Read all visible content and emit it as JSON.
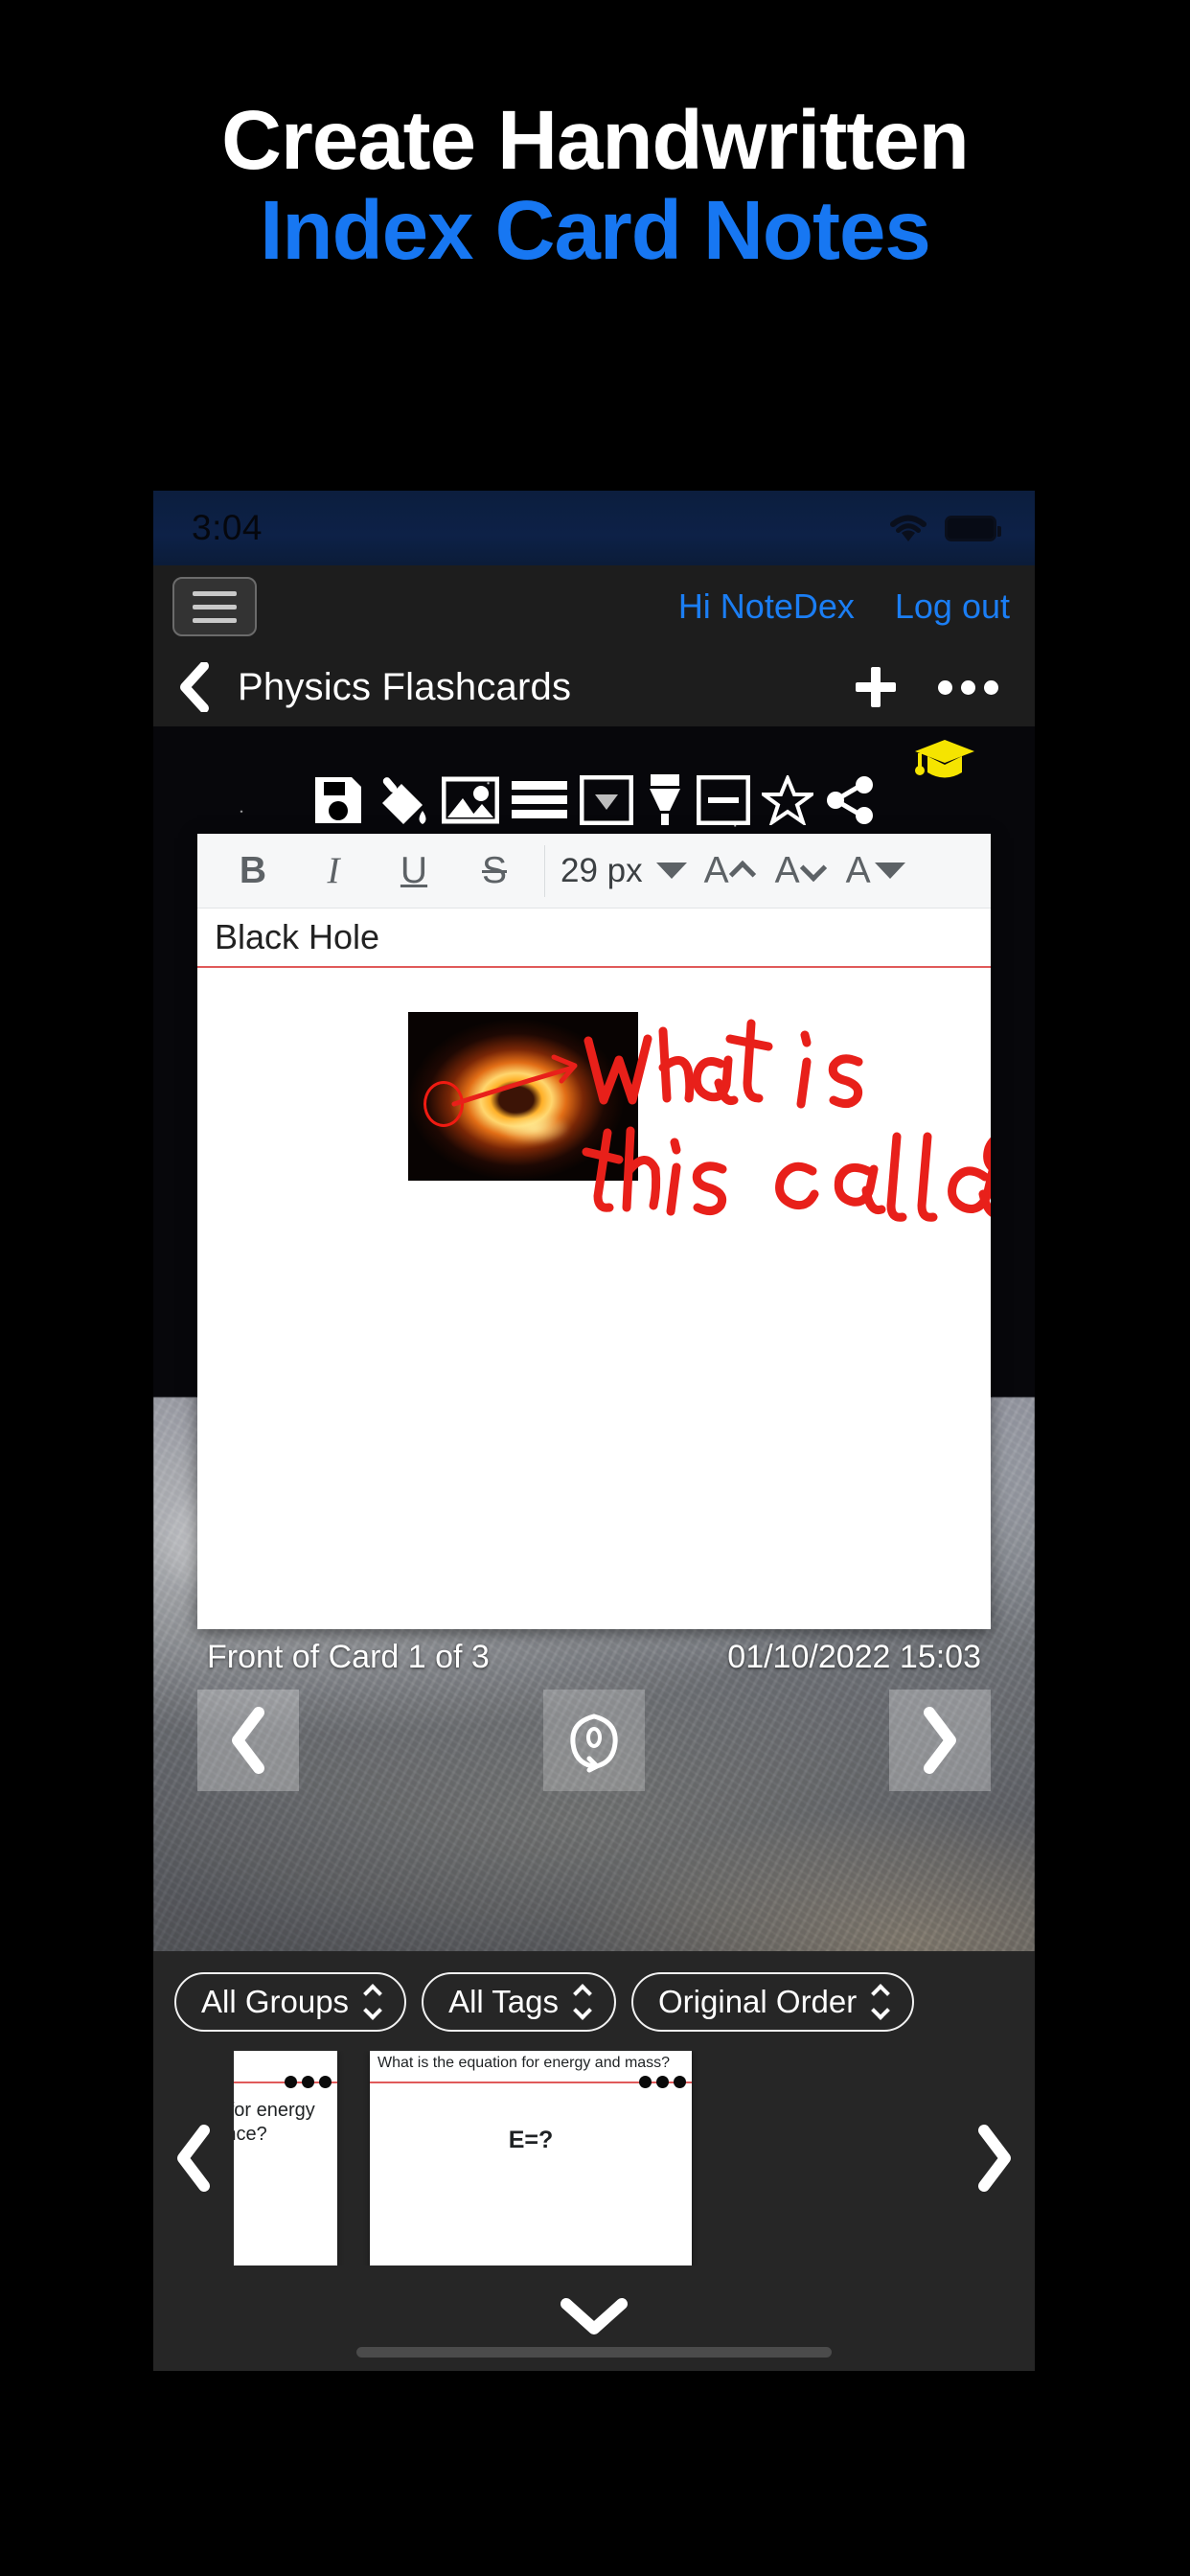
{
  "promo": {
    "headline_line1": "Create Handwritten",
    "headline_line2": "Index Card Notes",
    "accent_color": "#1777f2",
    "background_color": "#000000"
  },
  "status_bar": {
    "time": "3:04",
    "wifi_icon": "wifi-icon",
    "battery_icon": "battery-icon",
    "background_color": "#0d2147"
  },
  "account_bar": {
    "menu_icon": "hamburger-menu-icon",
    "greeting": "Hi NoteDex",
    "logout": "Log out",
    "link_color": "#1b7ef4"
  },
  "title_bar": {
    "back_icon": "chevron-left-icon",
    "title": "Physics Flashcards",
    "add_icon": "plus-icon",
    "more_icon": "ellipsis-icon"
  },
  "editor_toolbar": {
    "items": [
      {
        "name": "save-icon",
        "label": "Save"
      },
      {
        "name": "paint-bucket-icon",
        "label": "Fill color"
      },
      {
        "name": "image-icon",
        "label": "Insert image"
      },
      {
        "name": "lines-icon",
        "label": "Line style"
      },
      {
        "name": "dropdown-box-icon",
        "label": "Template"
      },
      {
        "name": "marker-pen-icon",
        "label": "Pen"
      },
      {
        "name": "divider-box-icon",
        "label": "Layout"
      },
      {
        "name": "star-icon",
        "label": "Favorite"
      },
      {
        "name": "share-icon",
        "label": "Share"
      }
    ],
    "study_mode_icon": "graduation-cap-icon",
    "study_mode_color": "#f5e400"
  },
  "rich_text_toolbar": {
    "bold": "B",
    "italic": "I",
    "underline": "U",
    "strikethrough": "S",
    "font_size": "29 px",
    "increase_size": "A",
    "decrease_size": "A",
    "text_color": "A"
  },
  "card": {
    "title": "Black Hole",
    "handwriting_line1": "What is",
    "handwriting_line2": "this called?",
    "handwriting_color": "#e8201a",
    "image_name": "black-hole-photo",
    "footer_label": "Front of Card 1 of 3",
    "footer_date": "01/10/2022 15:03",
    "prev_icon": "chevron-left-icon",
    "flip_icon": "rotate-flip-icon",
    "next_icon": "chevron-right-icon"
  },
  "filters": [
    {
      "name": "groups-filter",
      "label": "All Groups"
    },
    {
      "name": "tags-filter",
      "label": "All Tags"
    },
    {
      "name": "order-filter",
      "label": "Original Order"
    }
  ],
  "carousel": {
    "prev_icon": "chevron-left-icon",
    "next_icon": "chevron-right-icon",
    "cards": [
      {
        "name": "card-thumbnail-1",
        "question": "ormula for energy",
        "question_line2": "quivalence?",
        "answer": "",
        "more_icon": "ellipsis-icon"
      },
      {
        "name": "card-thumbnail-2",
        "question": "What is the equation for energy and mass?",
        "question_line2": "",
        "answer": "E=?",
        "more_icon": "ellipsis-icon"
      }
    ]
  },
  "sheet": {
    "collapse_icon": "chevron-down-icon",
    "home_indicator": "home-indicator"
  }
}
